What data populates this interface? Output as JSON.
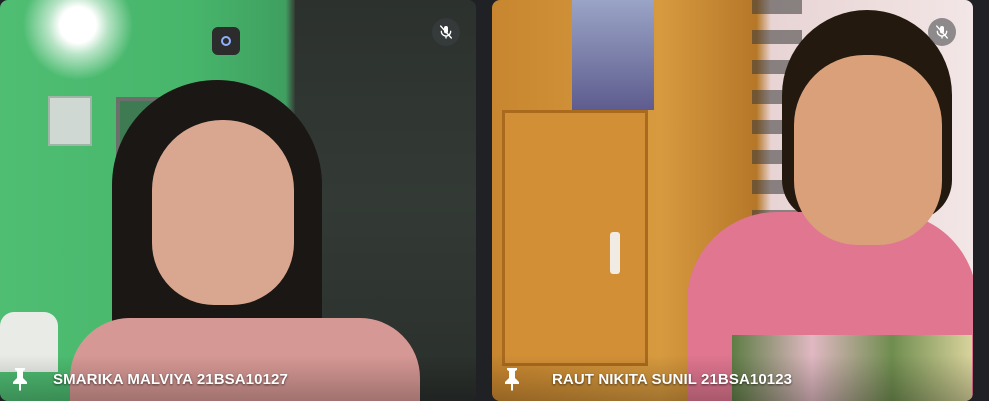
{
  "participants": [
    {
      "name": "SMARIKA MALVIYA 21BSA10127",
      "muted": true,
      "pinned": true
    },
    {
      "name": "RAUT NIKITA SUNIL 21BSA10123",
      "muted": true,
      "pinned": true
    }
  ],
  "icons": {
    "mute": "mic-off-icon",
    "pin": "pin-icon"
  },
  "colors": {
    "page_background": "#202124",
    "label_text": "#ffffff"
  }
}
